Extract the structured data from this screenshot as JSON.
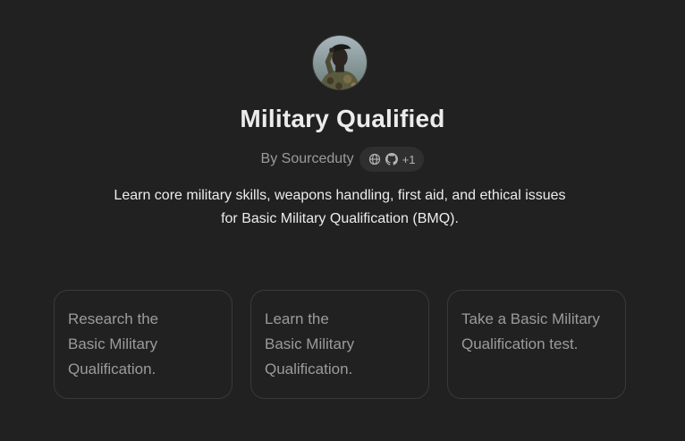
{
  "gpt": {
    "avatar_icon": "soldier-saluting-avatar",
    "title": "Military Qualified",
    "author": "By Sourceduty",
    "badge": {
      "icons": [
        "globe-icon",
        "github-icon"
      ],
      "extra_count": "+1"
    },
    "description_line1": "Learn core military skills, weapons handling, first aid, and ethical issues",
    "description_line2": "for Basic Military Qualification (BMQ)."
  },
  "starters": [
    {
      "lines": [
        "Research the",
        "Basic Military",
        "Qualification."
      ]
    },
    {
      "lines": [
        "Learn the",
        "Basic Military",
        "Qualification."
      ]
    },
    {
      "lines": [
        "Take a Basic Military",
        "Qualification test."
      ]
    }
  ],
  "colors": {
    "background": "#212121",
    "text_primary": "#ececec",
    "text_secondary": "#9b9b9b",
    "card_border": "#3a3a3a",
    "badge_bg": "#2f2f2f"
  }
}
